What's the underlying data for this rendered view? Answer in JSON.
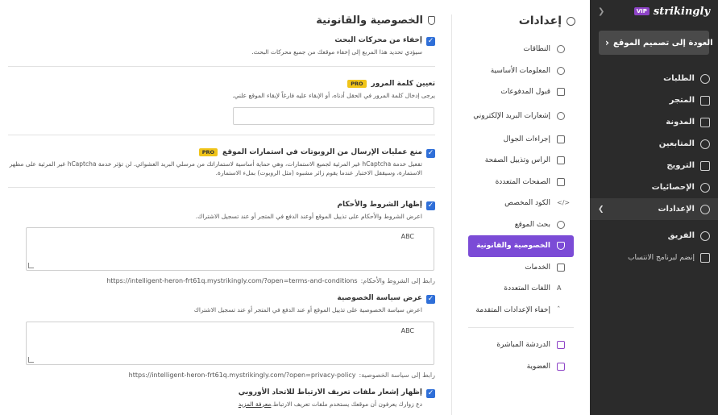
{
  "sidebar": {
    "brand": "strikingly",
    "vip": "VIP",
    "back_label": "العودة إلى تصميم الموقع",
    "items": [
      {
        "label": "الطلبات",
        "icon": "dollar-icon"
      },
      {
        "label": "المتجر",
        "icon": "store-icon"
      },
      {
        "label": "المدونة",
        "icon": "pen-icon"
      },
      {
        "label": "المتابعين",
        "icon": "users-icon"
      },
      {
        "label": "الترويج",
        "icon": "megaphone-icon"
      },
      {
        "label": "الإحصائيات",
        "icon": "chart-pie-icon"
      },
      {
        "label": "الإعدادات",
        "icon": "gear-icon"
      },
      {
        "label": "الفريق",
        "icon": "team-icon"
      },
      {
        "label": "إنضم لبرنامج الانتساب",
        "icon": "trophy-icon"
      }
    ]
  },
  "settings_nav": {
    "title": "إعدادات",
    "items": [
      {
        "label": "النطاقات",
        "icon": "globe-icon"
      },
      {
        "label": "المعلومات الأساسية",
        "icon": "info-icon"
      },
      {
        "label": "قبول المدفوعات",
        "icon": "payment-icon"
      },
      {
        "label": "إشعارات البريد الإلكتروني",
        "icon": "bell-icon"
      },
      {
        "label": "إجراءات الجوال",
        "icon": "mobile-icon"
      },
      {
        "label": "الراس وتذييل الصفحة",
        "icon": "layout-icon"
      },
      {
        "label": "الصفحات المتعددة",
        "icon": "pages-icon"
      },
      {
        "label": "الكود المخصص",
        "icon": "code-icon"
      },
      {
        "label": "بحث الموقع",
        "icon": "search-icon"
      },
      {
        "label": "الخصوصية والقانونية",
        "icon": "shield-icon"
      },
      {
        "label": "الخدمات",
        "icon": "grid-icon"
      },
      {
        "label": "اللغات المتعددة",
        "icon": "translate-icon"
      },
      {
        "label": "إخفاء الإعدادات المتقدمة",
        "icon": "chevron-up-icon"
      }
    ],
    "extra": [
      {
        "label": "الدردشة المباشرة",
        "icon": "chat-icon"
      },
      {
        "label": "العضوية",
        "icon": "membership-icon"
      }
    ]
  },
  "content": {
    "title": "الخصوصية والقانونية",
    "pro": "PRO",
    "hide_search": {
      "title": "إخفاء من محركات البحث",
      "desc": "سيؤدي تحديد هذا المربع إلى إخفاء موقعك من جميع محركات البحث."
    },
    "password": {
      "title": "تعيين كلمة المرور",
      "desc": "يرجى إدخال كلمة المرور في الحقل أدناه، أو الإبقاء عليه فارغاً لإبقاء الموقع علني.",
      "value": ""
    },
    "captcha": {
      "title": "منع عمليات الإرسال من الروبوتات في استمارات الموقع",
      "desc": "تفعيل خدمة hCaptcha غير المرئية لجميع الاستمارات، وهي حماية أساسية لاستماراتك من مرسلي البريد العشوائي. لن تؤثر خدمة hCaptcha غير المرئية على مظهر الاستمارة، وسيقفل الاختبار عندما يقوم زائر مشبوه (مثل الروبوت) بملء الاستمارة."
    },
    "terms": {
      "title": "إظهار الشروط والأحكام",
      "desc": "اعرض الشروط والأحكام على تذييل الموقع أوعند الدفع في المتجر أو عند تسجيل الاشتراك.",
      "text": "ABC",
      "link_label": "رابط إلى الشروط والأحكام:",
      "url": "https://intelligent-heron-frt61q.mystrikingly.com/?open=terms-and-conditions"
    },
    "privacy": {
      "title": "عرض سياسة الخصوصية",
      "desc": "اعرض سياسة الخصوصية على تذييل الموقع أو عند الدفع في المتجر أو عند تسجيل الاشتراك",
      "text": "ABC",
      "link_label": "رابط إلى سياسة الخصوصية:",
      "url": "https://intelligent-heron-frt61q.mystrikingly.com/?open=privacy-policy"
    },
    "cookies": {
      "title": "إظهار إشعار ملفات تعريف الارتباط للاتحاد الأوروبي",
      "desc": "دع زوارك يعرفون أن موقعك يستخدم ملفات تعريف الارتباط.",
      "more": "معرفة المزيد"
    }
  }
}
